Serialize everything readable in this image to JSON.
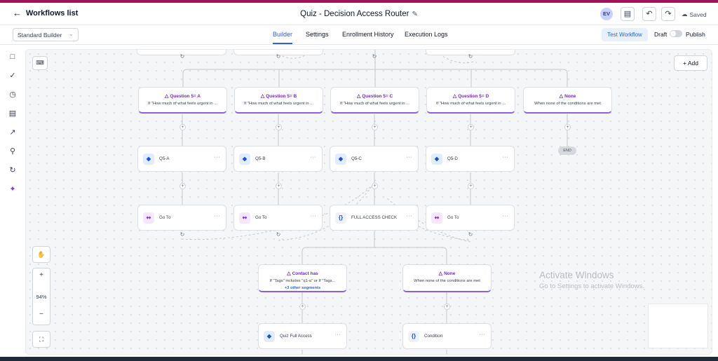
{
  "header": {
    "back_label": "Workflows list",
    "title": "Quiz - Decision Access Router",
    "avatar_initials": "EV",
    "saved_label": "Saved"
  },
  "subbar": {
    "builder_select": "Standard Builder",
    "tabs": [
      {
        "label": "Builder",
        "active": true
      },
      {
        "label": "Settings",
        "active": false
      },
      {
        "label": "Enrollment History",
        "active": false
      },
      {
        "label": "Execution Logs",
        "active": false
      }
    ],
    "test_workflow_label": "Test Workflow",
    "draft_label": "Draft",
    "publish_label": "Publish",
    "publish_toggle_on": false
  },
  "canvas": {
    "add_label": "Add",
    "zoom_level": "94%",
    "branch_row1": [
      {
        "title": "Question 5= A",
        "desc": "If \"How much of what feels urgent in ..."
      },
      {
        "title": "Question 5= B",
        "desc": "If \"How much of what feels urgent in ..."
      },
      {
        "title": "Question 5= C",
        "desc": "If \"How much of what feels urgent in ..."
      },
      {
        "title": "Question 5= D",
        "desc": "If \"How much of what feels urgent in ..."
      },
      {
        "title": "None",
        "desc": "When none of the conditions are met"
      }
    ],
    "tag_row": [
      {
        "label": "Q5-A"
      },
      {
        "label": "Q5-B"
      },
      {
        "label": "Q5-C"
      },
      {
        "label": "Q5-D"
      }
    ],
    "end_label": "END",
    "row3": [
      {
        "label": "Go To",
        "icon": "goto"
      },
      {
        "label": "Go To",
        "icon": "goto"
      },
      {
        "label": "FULL ACCESS CHECK",
        "icon": "braces"
      },
      {
        "label": "Go To",
        "icon": "goto"
      }
    ],
    "branch_row2": [
      {
        "title": "Contact has",
        "desc": "If \"Tags\" includes \"q1-a\" or If \"Tags...",
        "extra": "+3 other segments"
      },
      {
        "title": "None",
        "desc": "When none of the conditions are met",
        "extra": ""
      }
    ],
    "row5": [
      {
        "label": "Quiz Full Access",
        "icon": "tag"
      },
      {
        "label": "Condition",
        "icon": "braces"
      }
    ]
  },
  "watermark": {
    "line1": "Activate Windows",
    "line2": "Go to Settings to activate Windows."
  },
  "colors": {
    "accent": "#2563eb",
    "condition_purple": "#8b5cf6",
    "brand_strip": "#a3115a"
  }
}
